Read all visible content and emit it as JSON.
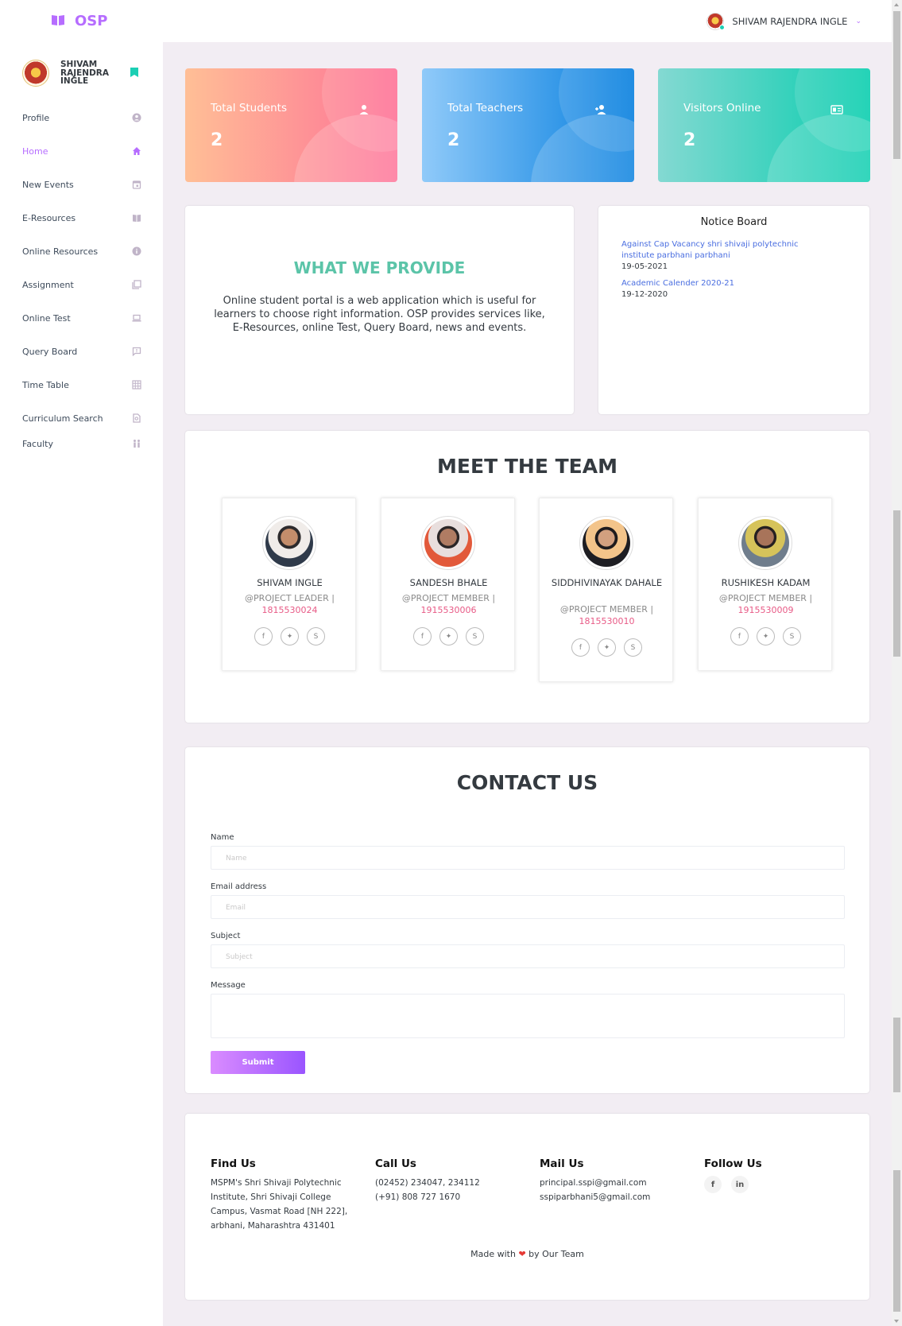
{
  "brand": {
    "name": "OSP"
  },
  "user": {
    "name": "SHIVAM RAJENDRA INGLE"
  },
  "profile": {
    "line1": "SHIVAM",
    "line2": "RAJENDRA",
    "line3": "INGLE"
  },
  "sidebar": {
    "items": [
      {
        "label": "Profile",
        "icon": "user-circle-icon"
      },
      {
        "label": "Home",
        "icon": "home-icon"
      },
      {
        "label": "New Events",
        "icon": "calendar-icon"
      },
      {
        "label": "E-Resources",
        "icon": "book-icon"
      },
      {
        "label": "Online Resources",
        "icon": "info-icon"
      },
      {
        "label": "Assignment",
        "icon": "files-icon"
      },
      {
        "label": "Online Test",
        "icon": "laptop-icon"
      },
      {
        "label": "Query Board",
        "icon": "chat-question-icon"
      },
      {
        "label": "Time Table",
        "icon": "grid-icon"
      },
      {
        "label": "Curriculum Search",
        "icon": "file-search-icon"
      },
      {
        "label": "Faculty",
        "icon": "people-icon"
      }
    ]
  },
  "stats": [
    {
      "label": "Total Students",
      "value": "2",
      "icon": "user-icon"
    },
    {
      "label": "Total Teachers",
      "value": "2",
      "icon": "user-plus-icon"
    },
    {
      "label": "Visitors Online",
      "value": "2",
      "icon": "id-card-icon"
    }
  ],
  "provide": {
    "title": "WHAT WE PROVIDE",
    "text": "Online student portal is a web application which is useful for learners to choose right information. OSP provides services like, E-Resources, online Test, Query Board, news and events."
  },
  "notice": {
    "title": "Notice Board",
    "items": [
      {
        "link": "Against Cap Vacancy shri shivaji polytechnic institute parbhani parbhani",
        "date": "19-05-2021"
      },
      {
        "link": "Academic Calender 2020-21",
        "date": "19-12-2020"
      }
    ]
  },
  "team": {
    "title": "MEET THE TEAM",
    "members": [
      {
        "name": "SHIVAM INGLE",
        "role": "@PROJECT LEADER |",
        "id": "1815530024"
      },
      {
        "name": "SANDESH BHALE",
        "role": "@PROJECT MEMBER |",
        "id": "1915530006"
      },
      {
        "name": "SIDDHIVINAYAK DAHALE",
        "role": "@PROJECT MEMBER |",
        "id": "1815530010"
      },
      {
        "name": "RUSHIKESH KADAM",
        "role": "@PROJECT MEMBER |",
        "id": "1915530009"
      }
    ]
  },
  "contact": {
    "title": "CONTACT US",
    "name_label": "Name",
    "name_placeholder": "Name",
    "email_label": "Email address",
    "email_placeholder": "Email",
    "subject_label": "Subject",
    "subject_placeholder": "Subject",
    "message_label": "Message",
    "submit_label": "Submit"
  },
  "footer": {
    "find_title": "Find Us",
    "find_text": "MSPM's Shri Shivaji Polytechnic Institute, Shri Shivaji College Campus, Vasmat Road [NH 222], arbhani, Maharashtra 431401",
    "call_title": "Call Us",
    "call_line1": "(02452) 234047, 234112",
    "call_line2": "(+91) 808 727 1670",
    "mail_title": "Mail Us",
    "mail_line1": "principal.sspi@gmail.com",
    "mail_line2": "sspiparbhani5@gmail.com",
    "follow_title": "Follow Us",
    "made_prefix": "Made with",
    "made_suffix": "by Our Team"
  }
}
